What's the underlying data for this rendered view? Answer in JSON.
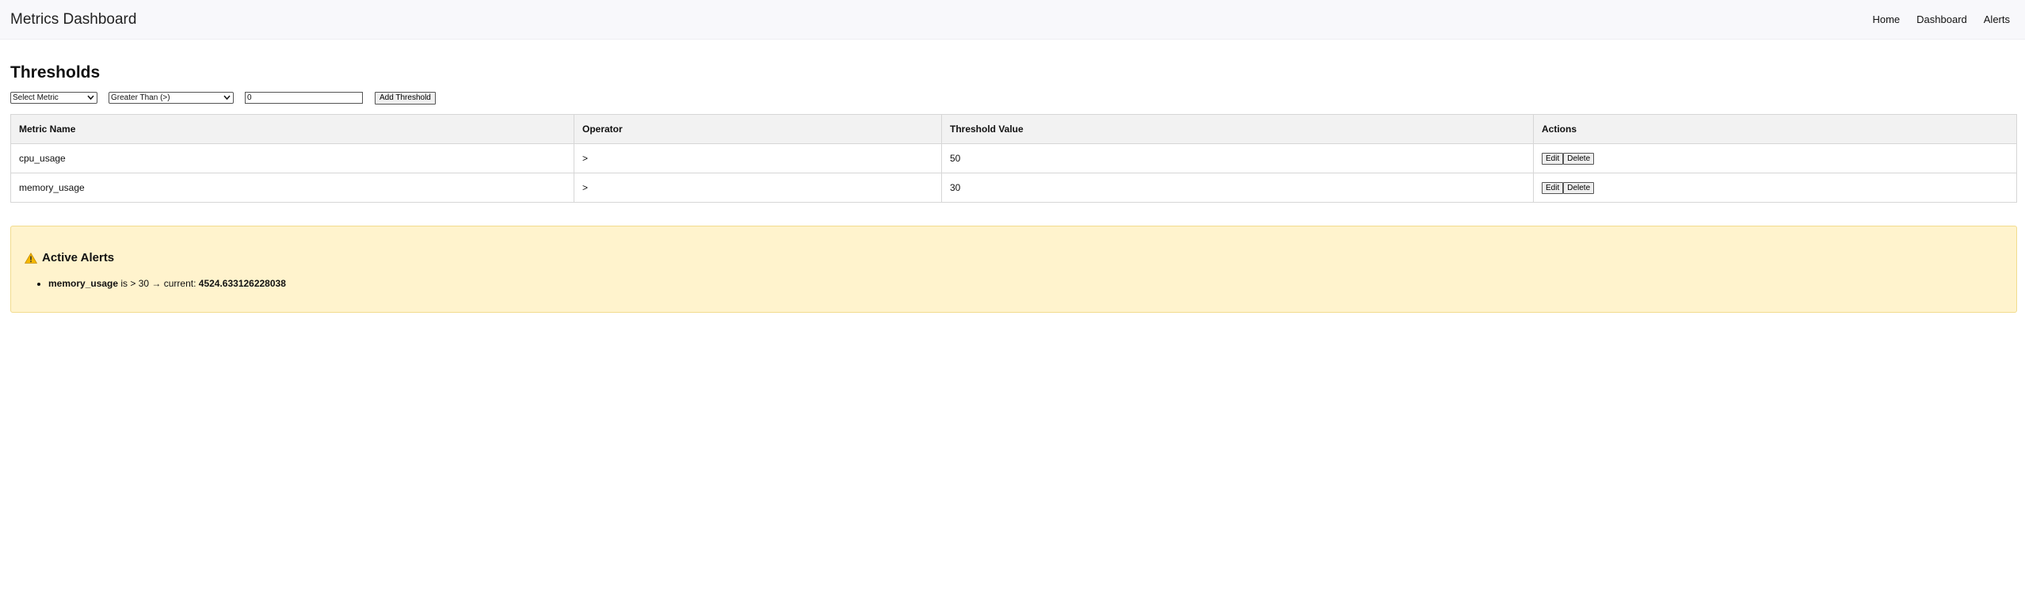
{
  "app": {
    "title": "Metrics Dashboard"
  },
  "nav": {
    "items": [
      {
        "label": "Home"
      },
      {
        "label": "Dashboard"
      },
      {
        "label": "Alerts"
      }
    ]
  },
  "thresholds": {
    "heading": "Thresholds",
    "metric_select": {
      "value": "Select Metric"
    },
    "operator_select": {
      "value": "Greater Than (>)"
    },
    "value_input": {
      "value": "0"
    },
    "add_button_label": "Add Threshold",
    "table": {
      "columns": [
        "Metric Name",
        "Operator",
        "Threshold Value",
        "Actions"
      ],
      "rows": [
        {
          "metric": "cpu_usage",
          "operator": ">",
          "value": "50",
          "edit_label": "Edit",
          "delete_label": "Delete"
        },
        {
          "metric": "memory_usage",
          "operator": ">",
          "value": "30",
          "edit_label": "Edit",
          "delete_label": "Delete"
        }
      ]
    }
  },
  "alerts": {
    "heading": "Active Alerts",
    "icon": "warning-icon",
    "items": [
      {
        "metric": "memory_usage",
        "condition_text": " is > 30 → current: ",
        "current": "4524.633126228038"
      }
    ]
  }
}
